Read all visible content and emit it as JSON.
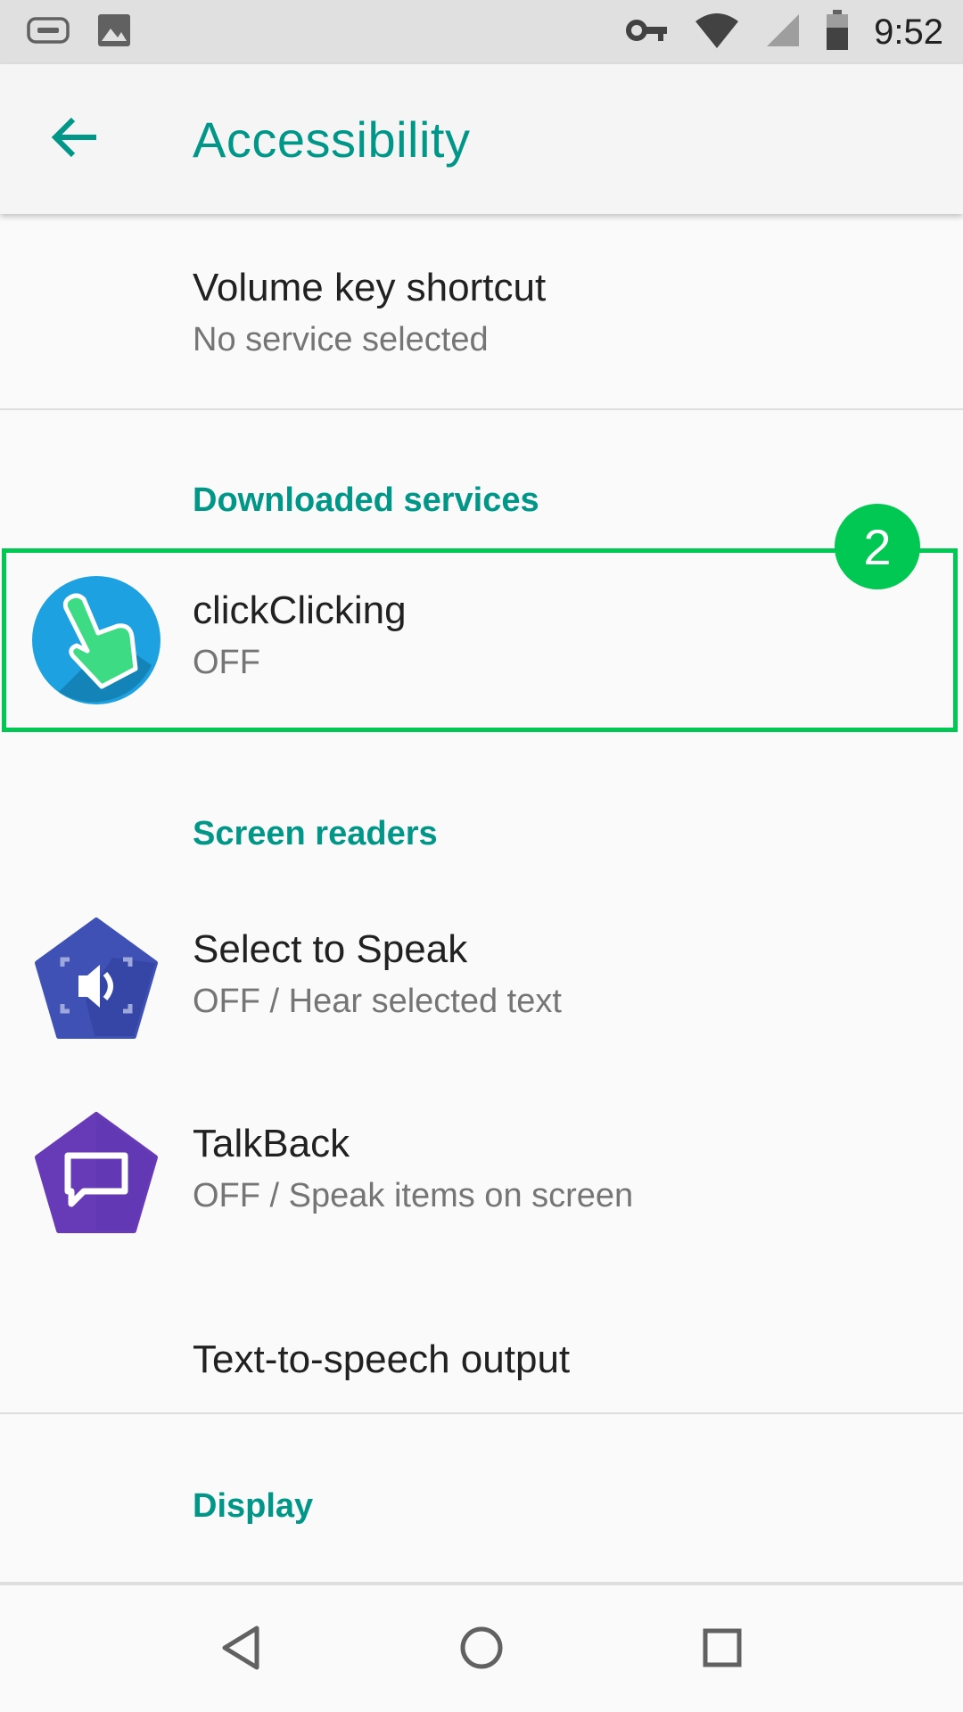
{
  "status_bar": {
    "time": "9:52",
    "left_icons": [
      "keyboard-icon",
      "image-icon"
    ],
    "right_icons": [
      "vpn-key-icon",
      "wifi-icon",
      "signal-icon",
      "battery-icon"
    ]
  },
  "app_bar": {
    "title": "Accessibility",
    "back_icon": "arrow-back-icon"
  },
  "items": {
    "volume_shortcut": {
      "title": "Volume key shortcut",
      "subtitle": "No service selected"
    },
    "downloaded_header": "Downloaded services",
    "click_clicking": {
      "title": "clickClicking",
      "subtitle": "OFF",
      "icon": "pointing-hand-icon"
    },
    "screen_readers_header": "Screen readers",
    "select_to_speak": {
      "title": "Select to Speak",
      "subtitle": "OFF / Hear selected text",
      "icon": "select-to-speak-icon"
    },
    "talkback": {
      "title": "TalkBack",
      "subtitle": "OFF / Speak items on screen",
      "icon": "talkback-icon"
    },
    "tts_output": {
      "title": "Text-to-speech output"
    },
    "display_header": "Display"
  },
  "annotation": {
    "badge_number": "2",
    "color": "#00c853"
  },
  "nav_bar": {
    "icons": [
      "back-triangle-icon",
      "home-circle-icon",
      "recents-square-icon"
    ]
  },
  "colors": {
    "accent": "#009688",
    "primary_text": "#212121",
    "secondary_text": "#757575",
    "background": "#fafafa"
  }
}
